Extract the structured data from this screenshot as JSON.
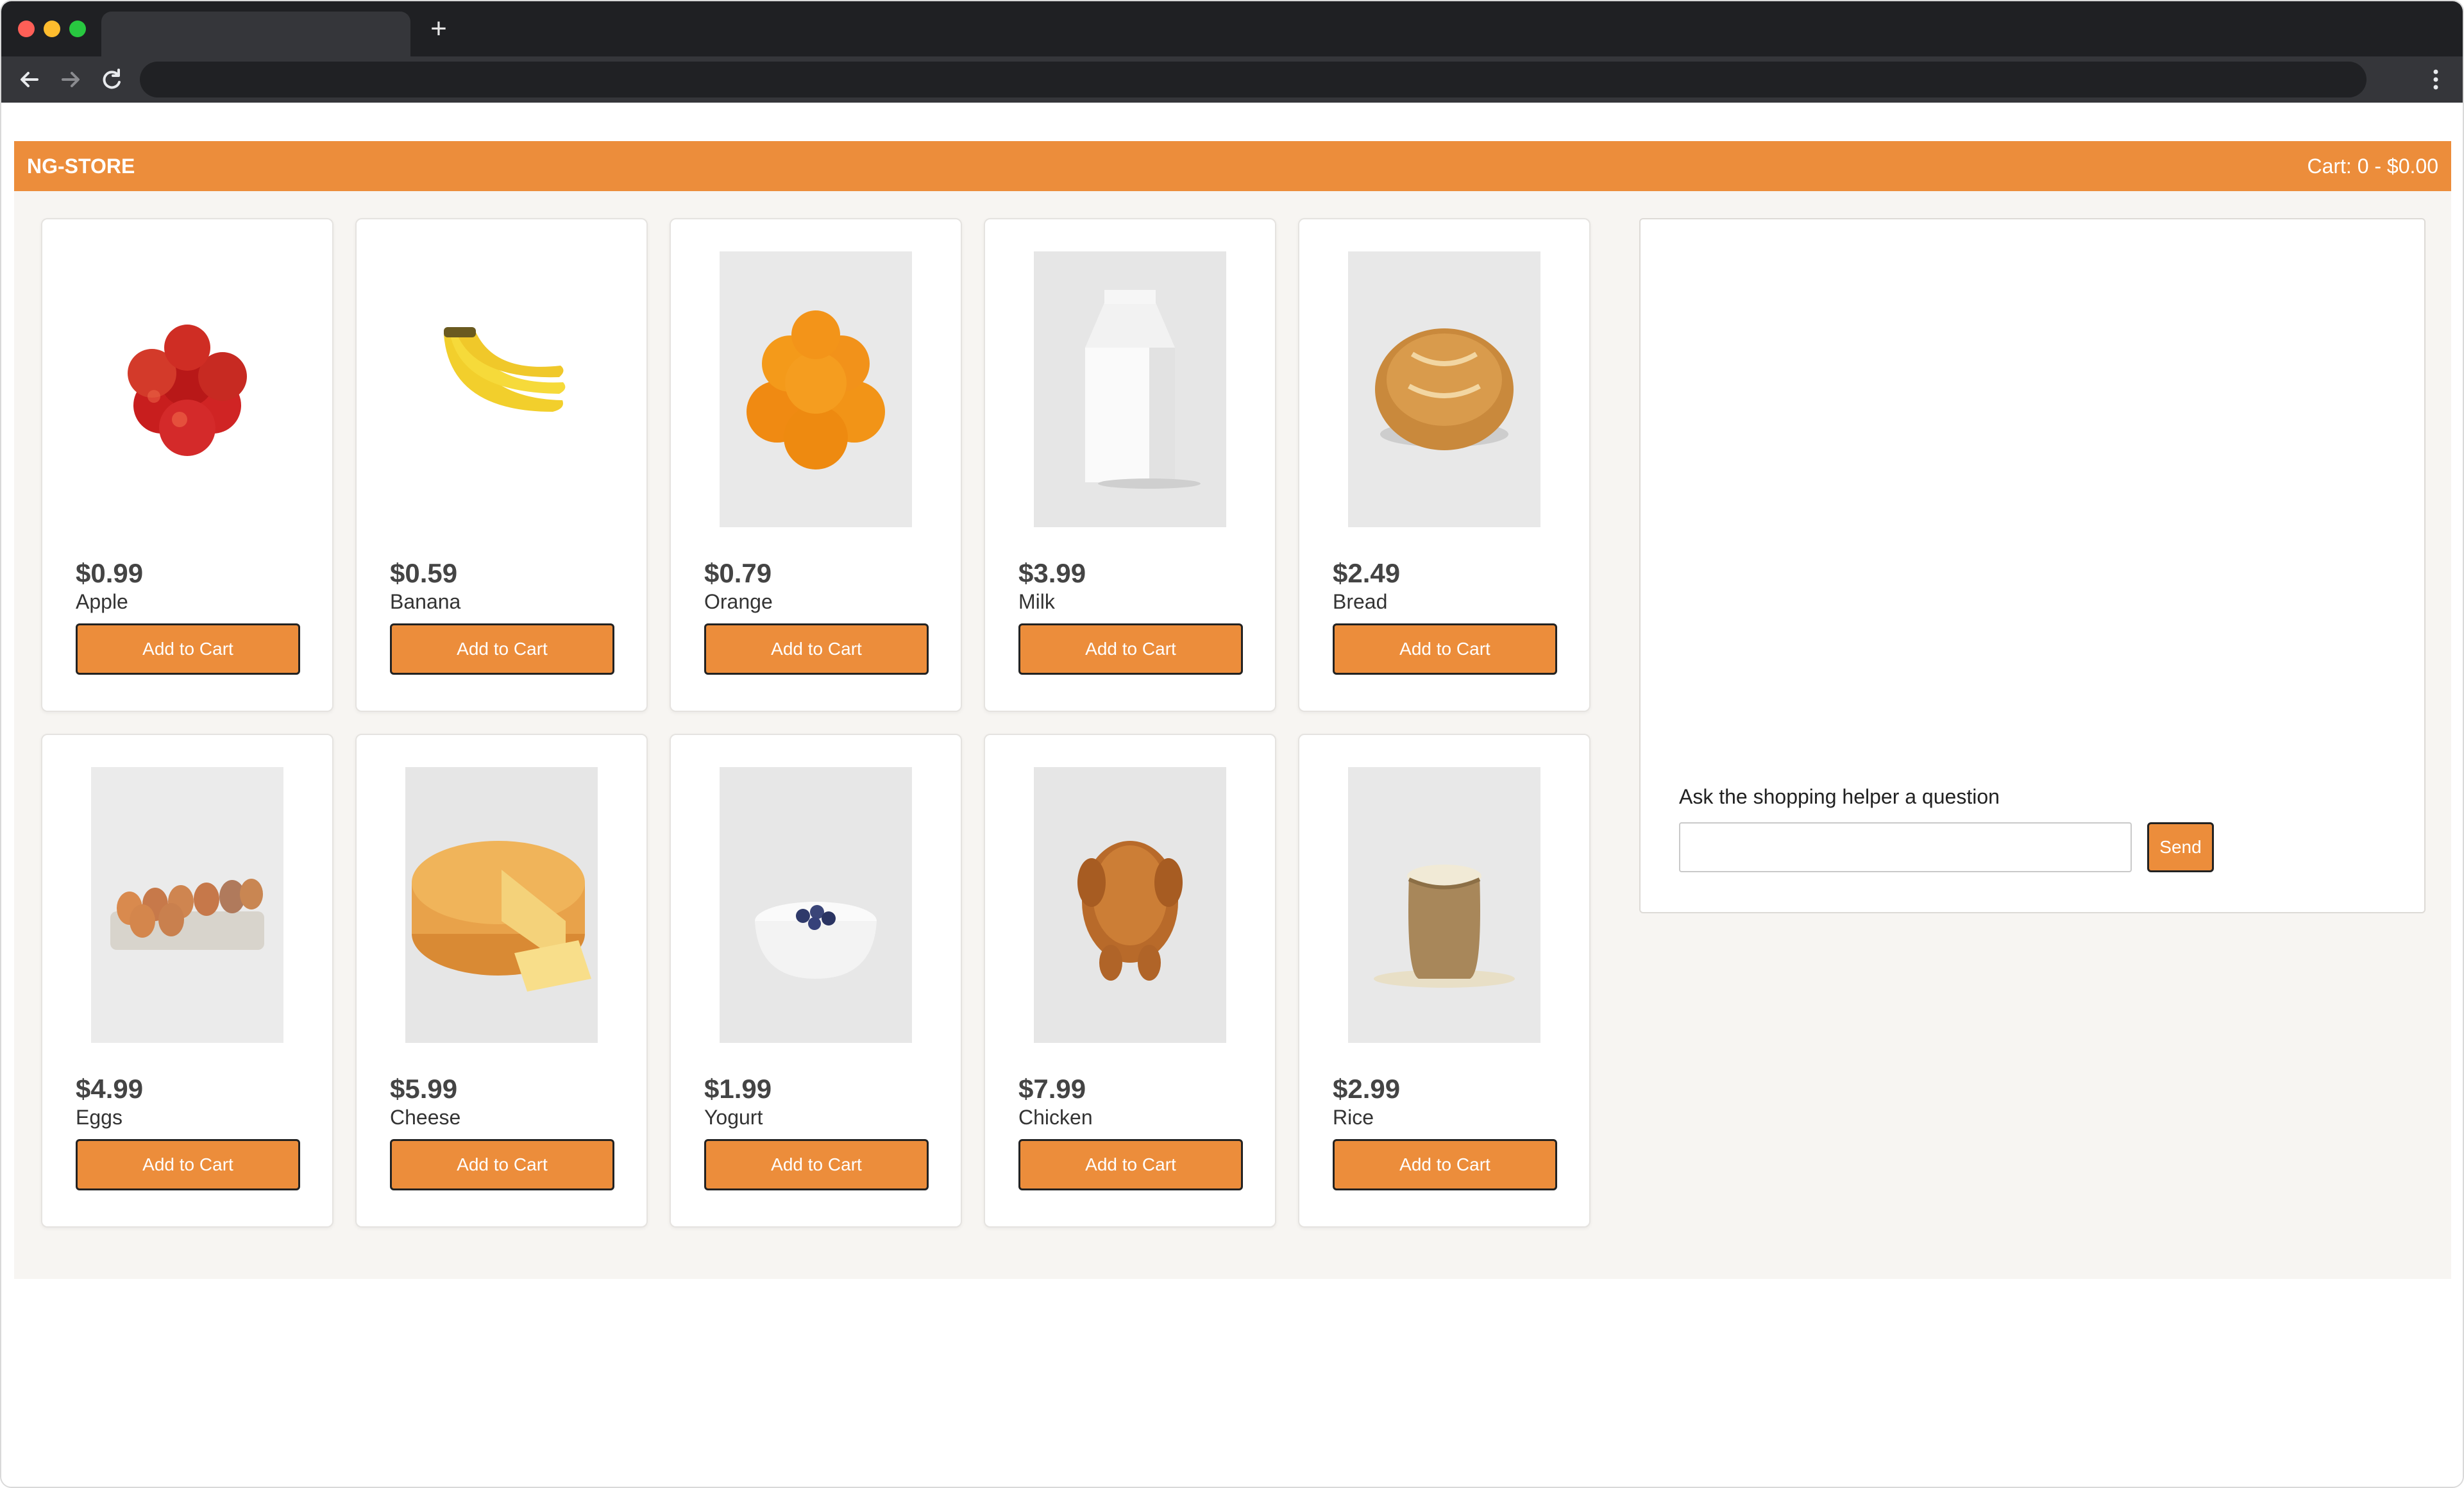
{
  "browser": {
    "new_tab_symbol": "+",
    "icons": [
      "back-arrow-icon",
      "forward-arrow-icon",
      "reload-icon",
      "more-vert-icon"
    ]
  },
  "store": {
    "brand": "NG-STORE",
    "cart_summary": "Cart: 0 - $0.00",
    "accent_color": "#ec8d3b"
  },
  "products": [
    {
      "price": "$0.99",
      "name": "Apple",
      "button": "Add to Cart"
    },
    {
      "price": "$0.59",
      "name": "Banana",
      "button": "Add to Cart"
    },
    {
      "price": "$0.79",
      "name": "Orange",
      "button": "Add to Cart"
    },
    {
      "price": "$3.99",
      "name": "Milk",
      "button": "Add to Cart"
    },
    {
      "price": "$2.49",
      "name": "Bread",
      "button": "Add to Cart"
    },
    {
      "price": "$4.99",
      "name": "Eggs",
      "button": "Add to Cart"
    },
    {
      "price": "$5.99",
      "name": "Cheese",
      "button": "Add to Cart"
    },
    {
      "price": "$1.99",
      "name": "Yogurt",
      "button": "Add to Cart"
    },
    {
      "price": "$7.99",
      "name": "Chicken",
      "button": "Add to Cart"
    },
    {
      "price": "$2.99",
      "name": "Rice",
      "button": "Add to Cart"
    }
  ],
  "helper": {
    "label": "Ask the shopping helper a question",
    "input_value": "",
    "send_label": "Send"
  }
}
